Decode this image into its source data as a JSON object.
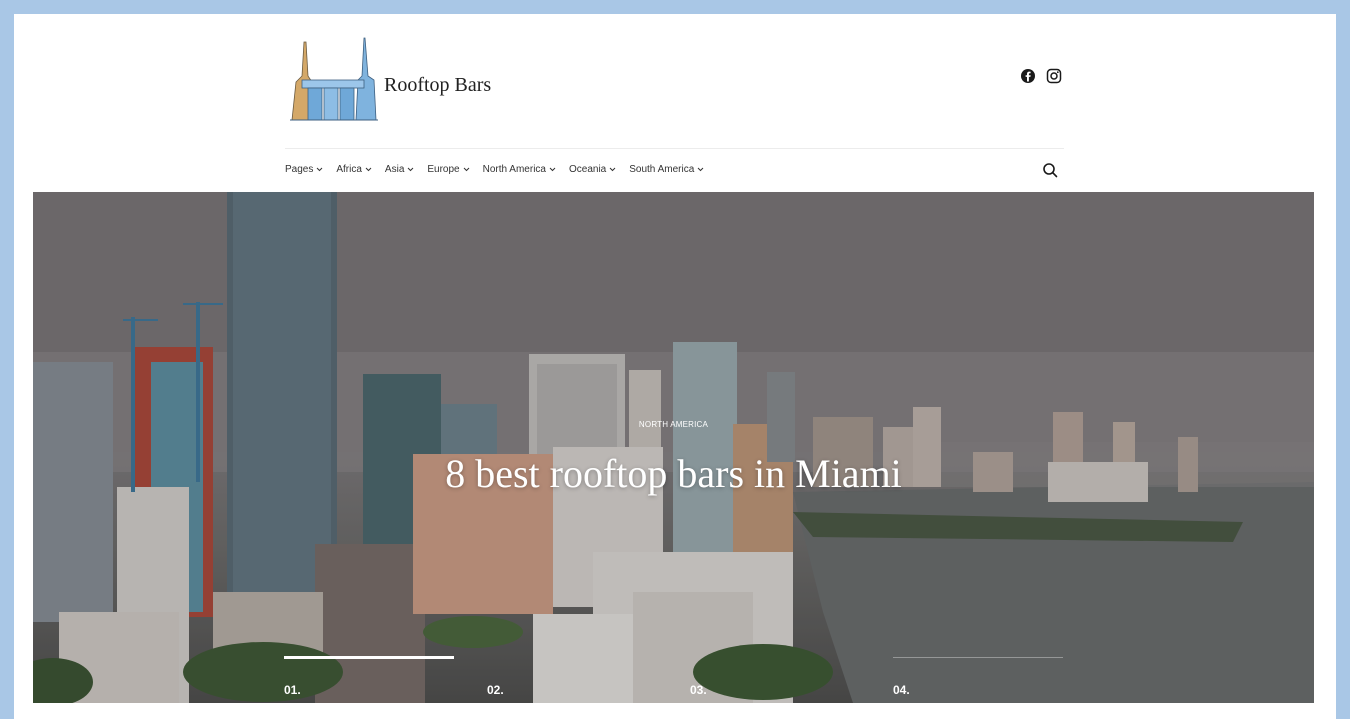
{
  "site": {
    "title": "Rooftop Bars"
  },
  "social": [
    {
      "icon": "facebook-icon"
    },
    {
      "icon": "instagram-icon"
    }
  ],
  "nav": {
    "items": [
      {
        "label": "Pages"
      },
      {
        "label": "Africa"
      },
      {
        "label": "Asia"
      },
      {
        "label": "Europe"
      },
      {
        "label": "North America"
      },
      {
        "label": "Oceania"
      },
      {
        "label": "South America"
      }
    ],
    "search_icon": "search-icon"
  },
  "hero": {
    "category": "NORTH AMERICA",
    "title": "8 best rooftop bars in Miami",
    "slides": [
      {
        "number": "01.",
        "active": true
      },
      {
        "number": "02.",
        "active": false
      },
      {
        "number": "03.",
        "active": false
      },
      {
        "number": "04.",
        "active": false
      }
    ]
  },
  "colors": {
    "page_border": "#a9c7e6",
    "logo_blue": "#6fa8d8",
    "logo_tan": "#d4a868",
    "text_dark": "#222222"
  }
}
